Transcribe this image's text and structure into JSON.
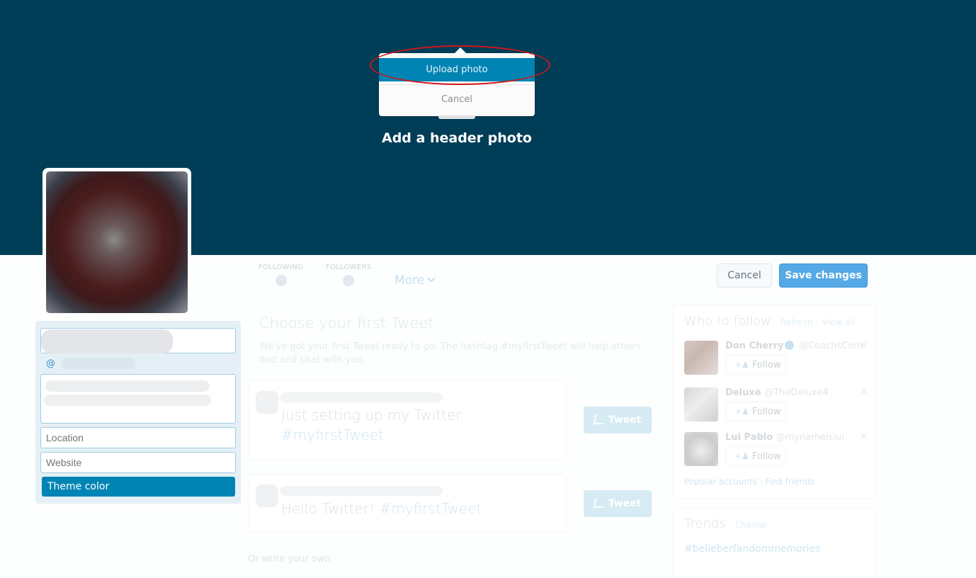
{
  "header": {
    "title": "Add a header photo",
    "background_color": "#003e58"
  },
  "photo_menu": {
    "upload_label": "Upload photo",
    "cancel_label": "Cancel",
    "highlight_color": "#d0161a"
  },
  "profile_nav": {
    "stats": [
      {
        "label": "FOLLOWING"
      },
      {
        "label": "FOLLOWERS"
      }
    ],
    "more_label": "More"
  },
  "actions": {
    "cancel_label": "Cancel",
    "save_label": "Save changes"
  },
  "edit_profile": {
    "at_symbol": "@",
    "location_placeholder": "Location",
    "website_placeholder": "Website",
    "theme_color_label": "Theme color",
    "theme_color": "#0084b4"
  },
  "first_tweet": {
    "title": "Choose your first Tweet",
    "description": "We've got your first Tweet ready to go. The hashtag #myfirstTweet will help others find and chat with you.",
    "suggestions": [
      {
        "text": "Just setting up my Twitter.",
        "hashtag": "#myfirstTweet",
        "button_label": "Tweet"
      },
      {
        "text": "Hello Twitter!",
        "hashtag": "#myfirstTweet",
        "button_label": "Tweet"
      }
    ],
    "write_own_label": "Or write your own"
  },
  "who_to_follow": {
    "title": "Who to follow",
    "refresh_label": "· Refresh",
    "view_all_label": "· View all",
    "accounts": [
      {
        "name": "Don Cherry",
        "handle": "@CoachsCorn.",
        "verified": true,
        "follow_label": "Follow"
      },
      {
        "name": "Deluxe",
        "handle": "@TheDeluxe4",
        "verified": false,
        "follow_label": "Follow"
      },
      {
        "name": "Lui Pablo",
        "handle": "@mynameislui",
        "verified": false,
        "follow_label": "Follow"
      }
    ],
    "popular_label": "Popular accounts",
    "find_friends_label": "· Find friends"
  },
  "trends": {
    "title": "Trends",
    "change_label": "· Change",
    "items": [
      "#belieberfandommemories"
    ]
  }
}
